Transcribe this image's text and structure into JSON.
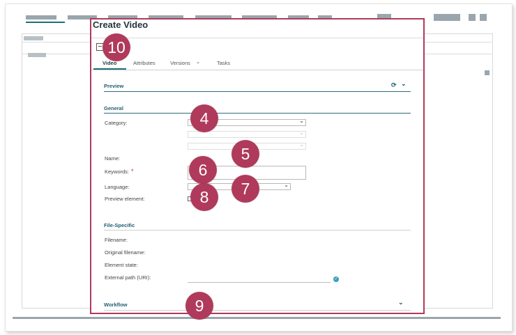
{
  "dialog": {
    "title": "Create Video",
    "tabs": [
      {
        "label": "Video",
        "active": true
      },
      {
        "label": "Attributes"
      },
      {
        "label": "Versions"
      },
      {
        "label": "Tasks"
      }
    ],
    "versions_chevron": "⌄"
  },
  "sections": {
    "preview": {
      "title": "Preview",
      "refresh_icon": "refresh-icon",
      "chevron": "⌄"
    },
    "general": {
      "title": "General"
    },
    "file_specific": {
      "title": "File-Specific"
    },
    "workflow": {
      "title": "Workflow",
      "chevron": "⌄"
    }
  },
  "fields": {
    "category": "Category:",
    "name": "Name:",
    "keywords": "Keywords:",
    "keywords_required": "*",
    "language": "Language:",
    "preview_element": "Preview element:",
    "filename": "Filename:",
    "original_filename": "Original filename:",
    "element_state": "Element state:",
    "external_path": "External path (URI):"
  },
  "callouts": [
    "10",
    "4",
    "5",
    "6",
    "7",
    "8",
    "9"
  ],
  "colors": {
    "accent": "#b03a5b",
    "teal": "#1d6f7a",
    "section_text": "#1f5f72"
  }
}
